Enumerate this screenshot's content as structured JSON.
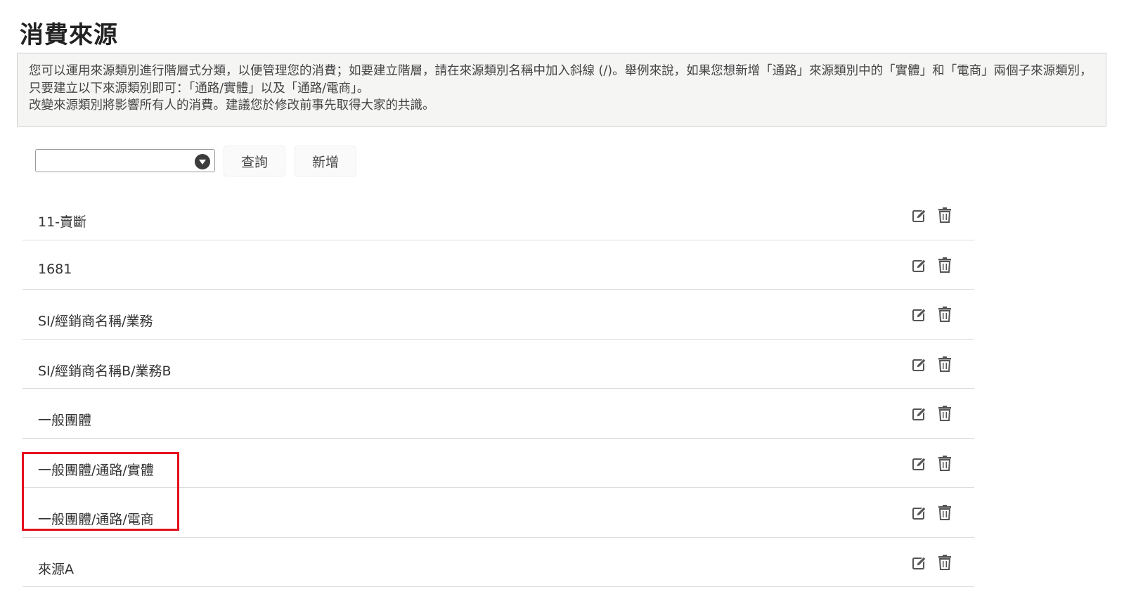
{
  "page": {
    "title": "消費來源"
  },
  "info": {
    "line1": "您可以運用來源類別進行階層式分類，以便管理您的消費；如要建立階層，請在來源類別名稱中加入斜線 (/)。舉例來說，如果您想新增「通路」來源類別中的「實體」和「電商」兩個子來源類別，只要建立以下來源類別即可：「通路/實體」以及「通路/電商」。",
    "line2": "改變來源類別將影響所有人的消費。建議您於修改前事先取得大家的共識。"
  },
  "toolbar": {
    "select_value": "",
    "query_label": "查詢",
    "add_label": "新增"
  },
  "sources": [
    {
      "name": "11-賣斷"
    },
    {
      "name": "1681"
    },
    {
      "name": "SI/經銷商名稱/業務"
    },
    {
      "name": "SI/經銷商名稱B/業務B"
    },
    {
      "name": "一般團體"
    },
    {
      "name": "一般團體/通路/實體"
    },
    {
      "name": "一般團體/通路/電商"
    },
    {
      "name": "來源A"
    }
  ],
  "icons": {
    "edit": "edit-icon",
    "delete": "trash-icon",
    "dropdown": "chevron-down-icon"
  },
  "colors": {
    "highlight": "#e3101a",
    "icon": "#555555"
  }
}
